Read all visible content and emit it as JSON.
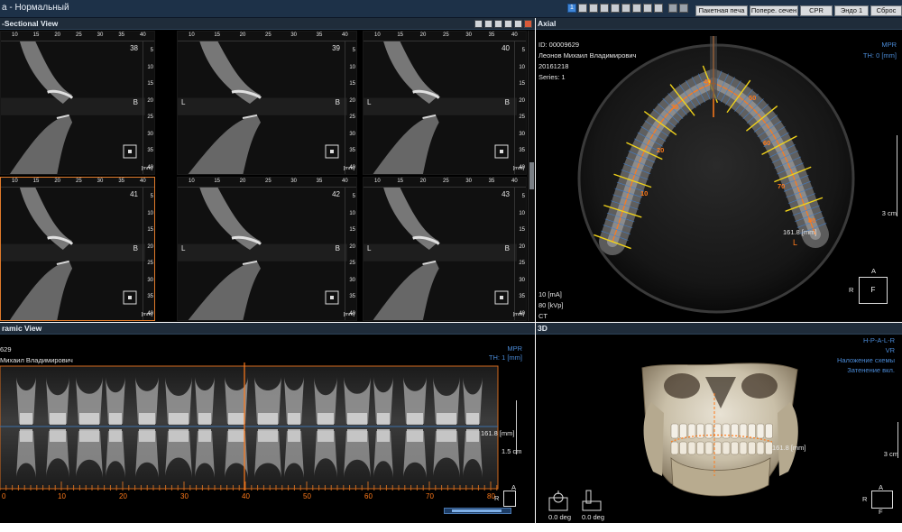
{
  "titlebar": {
    "title": "а - Нормальный",
    "mode_buttons": [
      "Пакетная печа",
      "Попере. сечен",
      "CPR",
      "Эндо 1",
      "Сброс"
    ],
    "layout_number": "1"
  },
  "cross_section": {
    "title": "-Sectional View",
    "ruler_ticks": [
      "10",
      "15",
      "20",
      "25",
      "30",
      "35",
      "40"
    ],
    "vruler_ticks": [
      "5",
      "10",
      "15",
      "20",
      "25",
      "30",
      "35",
      "40"
    ],
    "unit": "[mm]",
    "cells": [
      {
        "number": "38",
        "left_label": "",
        "right_label": "B"
      },
      {
        "number": "39",
        "left_label": "L",
        "right_label": "B"
      },
      {
        "number": "40",
        "left_label": "L",
        "right_label": "B"
      },
      {
        "number": "41",
        "left_label": "",
        "right_label": "B"
      },
      {
        "number": "42",
        "left_label": "L",
        "right_label": "B"
      },
      {
        "number": "43",
        "left_label": "L",
        "right_label": "B"
      }
    ]
  },
  "axial": {
    "title": "Axial",
    "patient_id": "ID: 00009629",
    "patient_name": "Леонов Михаил Владимирович",
    "date": "20161218",
    "series": "Series: 1",
    "mode": "MPR",
    "thickness": "TH: 0 [mm]",
    "ma": "10 [mA]",
    "kvp": "80 [kVp]",
    "modality": "CT",
    "scale": "3 cm",
    "arch_labels": [
      "40",
      "50",
      "30",
      "60",
      "20",
      "70",
      "10",
      "80"
    ],
    "measurement": "161.8 [mm]",
    "side_label": "L",
    "orient_a": "A",
    "orient_r": "R",
    "orient_f": "F"
  },
  "panoramic": {
    "title": "ramic View",
    "patient_id": "629",
    "patient_name": "Михаил Владимирович",
    "mode": "MPR",
    "thickness": "TH: 1 [mm]",
    "measurement": "161.8 [mm]",
    "scale": "1.5 cm",
    "axis_labels": [
      "0",
      "10",
      "20",
      "30",
      "40",
      "50",
      "60",
      "70",
      "80"
    ],
    "orient_a": "A",
    "orient_r": "R"
  },
  "three_d": {
    "title": "3D",
    "orientation": "H-P-A-L-R",
    "render_mode": "VR",
    "overlay": "Наложение схемы",
    "shading": "Затенение вкл.",
    "measurement": "161.8 [mm]",
    "scale": "3 cm",
    "rot1": "0.0 deg",
    "rot2": "0.0 deg",
    "orient_r": "R",
    "orient_a": "A",
    "orient_f": "F"
  },
  "colors": {
    "accent_blue": "#3f86d8",
    "measure_orange": "#ff7a1a",
    "guide_yellow": "#f0d21a",
    "panel_header": "#1f2c3a"
  }
}
